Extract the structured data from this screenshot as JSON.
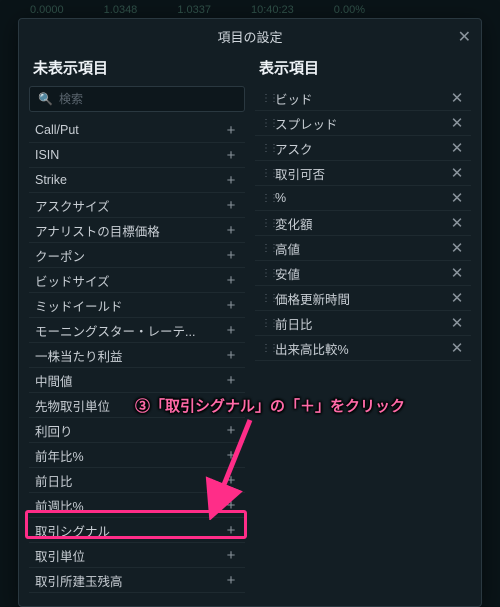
{
  "bg": {
    "v1": "0.0000",
    "v2": "1.0348",
    "v3": "1.0337",
    "v4": "10:40:23",
    "v5": "0.00%"
  },
  "modal": {
    "title": "項目の設定",
    "left_title": "未表示項目",
    "right_title": "表示項目",
    "search_placeholder": "検索",
    "left_items": [
      "Call/Put",
      "ISIN",
      "Strike",
      "アスクサイズ",
      "アナリストの目標価格",
      "クーポン",
      "ビッドサイズ",
      "ミッドイールド",
      "モーニングスター・レーテ...",
      "一株当たり利益",
      "中間値",
      "先物取引単位",
      "利回り",
      "前年比%",
      "前日比",
      "前週比%",
      "取引シグナル",
      "取引単位",
      "取引所建玉残高"
    ],
    "right_items": [
      "ビッド",
      "スプレッド",
      "アスク",
      "取引可否",
      "%",
      "変化額",
      "高値",
      "安値",
      "価格更新時間",
      "前日比",
      "出来高比較%"
    ]
  },
  "annotation": "③「取引シグナル」の「＋」をクリック",
  "colors": {
    "accent": "#ff2d88"
  }
}
